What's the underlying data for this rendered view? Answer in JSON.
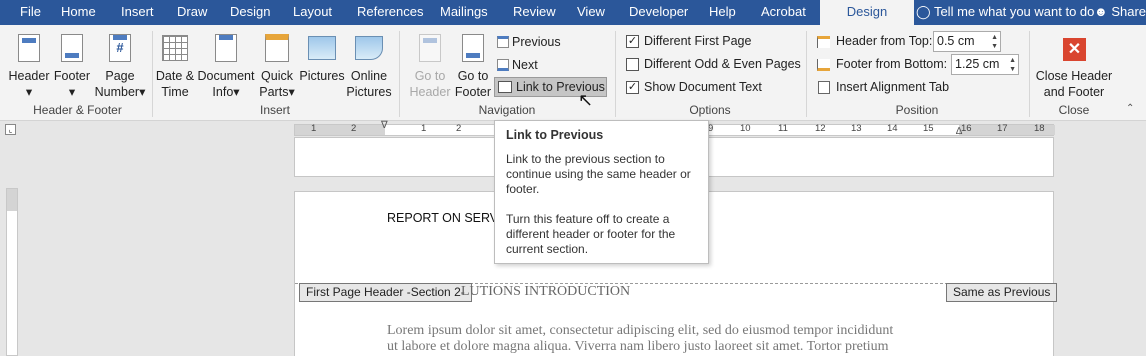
{
  "tabs": [
    "File",
    "Home",
    "Insert",
    "Draw",
    "Design",
    "Layout",
    "References",
    "Mailings",
    "Review",
    "View",
    "Developer",
    "Help",
    "Acrobat"
  ],
  "context_tab": "Design",
  "tellme": "Tell me what you want to do",
  "share": "Share",
  "groups": {
    "hf": {
      "label": "Header & Footer",
      "header": "Header",
      "footer": "Footer",
      "page_number": [
        "Page",
        "Number"
      ]
    },
    "insert": {
      "label": "Insert",
      "date_time": [
        "Date &",
        "Time"
      ],
      "document_info": [
        "Document",
        "Info"
      ],
      "quick_parts": [
        "Quick",
        "Parts"
      ],
      "pictures": "Pictures",
      "online_pictures": [
        "Online",
        "Pictures"
      ]
    },
    "navigation": {
      "label": "Navigation",
      "go_to_header": [
        "Go to",
        "Header"
      ],
      "go_to_footer": [
        "Go to",
        "Footer"
      ],
      "previous": "Previous",
      "next": "Next",
      "link_to_previous": "Link to Previous"
    },
    "options": {
      "label": "Options",
      "different_first_page": "Different First Page",
      "different_odd_even": "Different Odd & Even Pages",
      "show_document_text": "Show Document Text",
      "different_first_page_checked": true,
      "different_odd_even_checked": false,
      "show_document_text_checked": true
    },
    "position": {
      "label": "Position",
      "header_from_top_label": "Header from Top:",
      "header_from_top": "0.5 cm",
      "footer_from_bottom_label": "Footer from Bottom:",
      "footer_from_bottom": "1.25 cm",
      "insert_alignment_tab": "Insert Alignment Tab"
    },
    "close": {
      "label": "Close",
      "close_header_footer": [
        "Close Header",
        "and Footer"
      ]
    }
  },
  "ruler_numbers": [
    "1",
    "2",
    "1",
    "1",
    "2",
    "9",
    "10",
    "11",
    "12",
    "13",
    "14",
    "15",
    "16",
    "17",
    "18"
  ],
  "tooltip": {
    "title": "Link to Previous",
    "body1": "Link to the previous section to continue using the same header or footer.",
    "body2": "Turn this feature off to create a different header or footer for the current section."
  },
  "document": {
    "header_text": "REPORT ON SERVI",
    "header_tag": "First Page Header -Section 2-",
    "same_as_previous": "Same as Previous",
    "heading_fragment": "LUTIONS INTRODUCTION",
    "body_line1": "Lorem ipsum dolor sit amet, consectetur adipiscing elit, sed do eiusmod tempor incididunt",
    "body_line2": "ut labore et dolore magna aliqua. Viverra nam libero justo laoreet sit amet. Tortor pretium"
  }
}
